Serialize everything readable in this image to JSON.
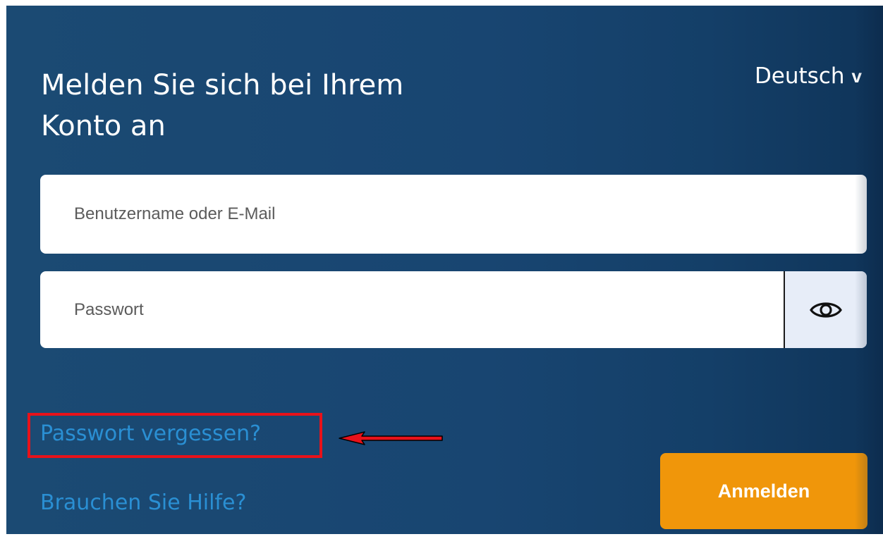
{
  "login": {
    "title": "Melden Sie sich bei Ihrem Konto an",
    "language": {
      "selected": "Deutsch",
      "chevron": "v",
      "icon": "chevron-down-icon"
    },
    "username": {
      "placeholder": "Benutzername oder E-Mail",
      "value": ""
    },
    "password": {
      "placeholder": "Passwort",
      "value": "",
      "toggle_icon": "eye-icon"
    },
    "forgot_password_label": "Passwort vergessen?",
    "help_label": "Brauchen Sie Hilfe?",
    "submit_label": "Anmelden"
  },
  "annotation": {
    "highlight_color": "#e8121a",
    "arrow_icon": "red-arrow-left-icon",
    "target": "forgot-password-link"
  },
  "colors": {
    "background": "#184571",
    "link": "#2a8fd3",
    "button": "#f0960a",
    "toggle_bg": "#e7edf8"
  }
}
